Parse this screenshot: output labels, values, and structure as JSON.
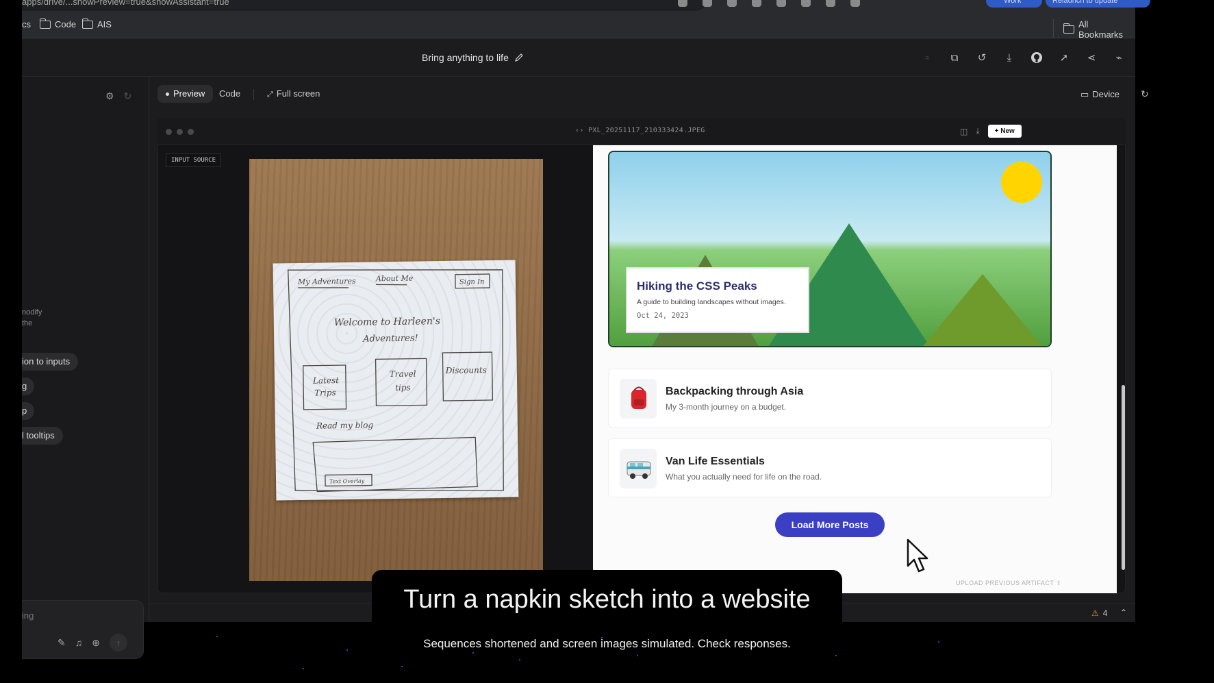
{
  "browser": {
    "url": "apps/drive/...showPreview=true&showAssistant=true",
    "profile_label": "Work",
    "relaunch_label": "Relaunch to update",
    "bookmarks": [
      {
        "label": "cs"
      },
      {
        "label": "Code"
      },
      {
        "label": "AIS"
      }
    ],
    "all_bookmarks_label": "All Bookmarks"
  },
  "app": {
    "project_title": "Bring anything to life",
    "tabs": [
      {
        "label": "Preview",
        "active": true
      },
      {
        "label": "Code",
        "active": false
      },
      {
        "label": "Full screen",
        "active": false
      }
    ],
    "device_label": "Device"
  },
  "left_panel": {
    "text_fragments": [
      "nodify",
      "the"
    ],
    "chips": [
      "ion to inputs",
      "g",
      "p",
      "l tooltips"
    ],
    "composer_placeholder": "ing"
  },
  "preview_window": {
    "filename": "PXL_20251117_210333424.JPEG",
    "new_button_label": "+ New",
    "input_source_label": "INPUT SOURCE"
  },
  "site": {
    "hero": {
      "title": "Hiking the CSS Peaks",
      "subtitle": "A guide to building landscapes without images.",
      "date": "Oct 24, 2023"
    },
    "posts": [
      {
        "title": "Backpacking through Asia",
        "desc": "My 3-month journey on a budget.",
        "icon": "backpack-icon"
      },
      {
        "title": "Van Life Essentials",
        "desc": "What you actually need for life on the road.",
        "icon": "van-icon"
      }
    ],
    "load_more_label": "Load More Posts",
    "upload_previous_label": "UPLOAD PREVIOUS ARTIFACT"
  },
  "napkin_sketch": {
    "nav": [
      "My Adventures",
      "About Me",
      "Sign In"
    ],
    "welcome": [
      "Welcome to Harleen's",
      "Adventures!"
    ],
    "boxes": [
      [
        "Latest",
        "Trips"
      ],
      [
        "Travel",
        "tips"
      ],
      [
        "Discounts"
      ]
    ],
    "read_blog": "Read my blog",
    "button": "Text Overlay"
  },
  "status_bar": {
    "warning_count": "4"
  },
  "caption": {
    "title": "Turn a napkin sketch into a website",
    "subtitle": "Sequences shortened and screen images simulated. Check responses."
  },
  "colors": {
    "accent_button": "#3a3fc4",
    "hero_title": "#2b2d6e",
    "warning": "#e88f3b",
    "sun": "#ffd400"
  }
}
